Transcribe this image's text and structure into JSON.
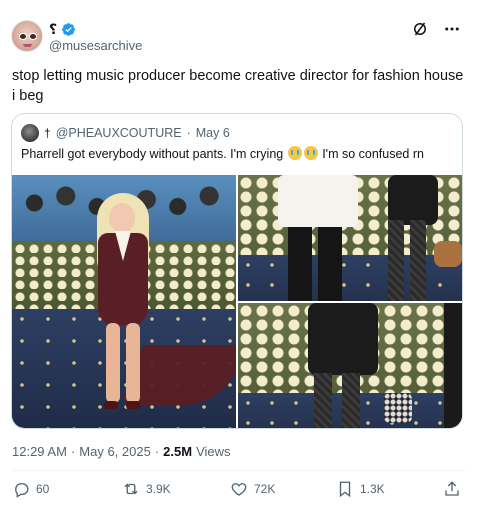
{
  "author": {
    "display_name": "⸮",
    "handle": "@musesarchive",
    "verified": true,
    "verified_color": "#1d9bf0"
  },
  "top_icons": [
    "grok-slash-icon",
    "more-icon"
  ],
  "post": {
    "text": "stop letting music producer become creative director for fashion house i beg"
  },
  "quote": {
    "dagger": "†",
    "handle": "@PHEAUXCOUTURE",
    "separator": "·",
    "date": "May 6",
    "text_before": "Pharrell got everybody without pants. I'm crying",
    "text_after": "I'm so confused rn",
    "emoji": [
      "crying-face",
      "crying-face"
    ]
  },
  "meta": {
    "time": "12:29 AM",
    "separator": "·",
    "date": "May 6, 2025",
    "separator2": "·",
    "views_count": "2.5M",
    "views_label": "Views"
  },
  "actions": {
    "replies": "60",
    "reposts": "3.9K",
    "likes": "72K",
    "bookmarks": "1.3K"
  },
  "colors": {
    "text": "#0f1419",
    "muted": "#536471",
    "border": "#cfd9de",
    "accent": "#1d9bf0"
  }
}
